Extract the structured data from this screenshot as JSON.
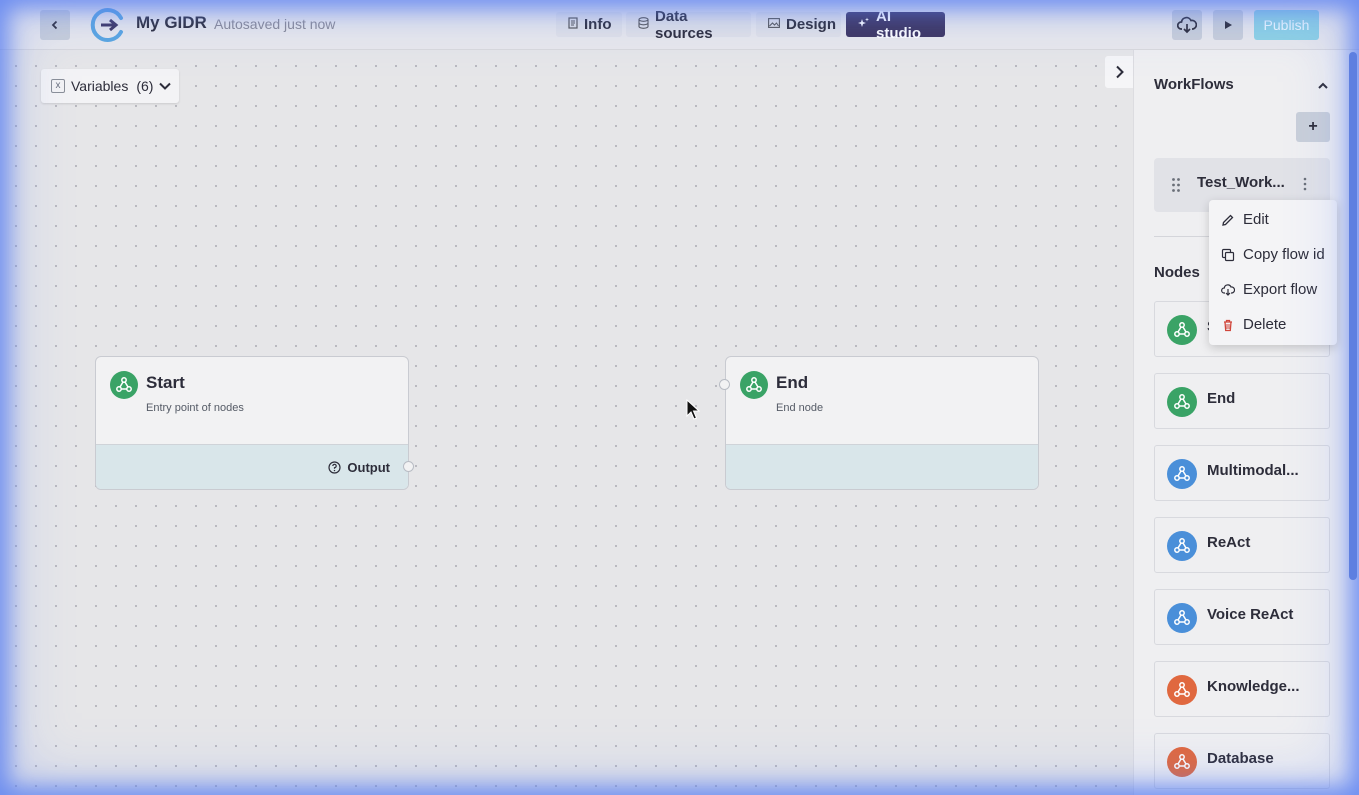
{
  "header": {
    "app_title": "My GIDR",
    "autosave_status": "Autosaved just now",
    "tabs": [
      {
        "label": "Info",
        "icon": "document-icon"
      },
      {
        "label": "Data sources",
        "icon": "database-icon"
      },
      {
        "label": "Design",
        "icon": "image-icon"
      },
      {
        "label": "AI studio",
        "icon": "sparkle-icon",
        "active": true
      }
    ],
    "publish_label": "Publish"
  },
  "canvas": {
    "variables_label": "Variables",
    "variables_count": "(6)",
    "nodes": [
      {
        "title": "Start",
        "subtitle": "Entry point of nodes",
        "output_label": "Output"
      },
      {
        "title": "End",
        "subtitle": "End node"
      }
    ]
  },
  "sidebar": {
    "workflows_title": "WorkFlows",
    "add_label": "+",
    "flow_name": "Test_Work...",
    "nodes_title": "Nodes",
    "node_palette": [
      {
        "label": "S",
        "color": "#3aa366"
      },
      {
        "label": "End",
        "color": "#3aa366"
      },
      {
        "label": "Multimodal...",
        "color": "#4a8fd9"
      },
      {
        "label": "ReAct",
        "color": "#4a8fd9"
      },
      {
        "label": "Voice ReAct",
        "color": "#4a8fd9"
      },
      {
        "label": "Knowledge...",
        "color": "#e0683f"
      },
      {
        "label": "Database",
        "color": "#e0683f"
      }
    ]
  },
  "context_menu": {
    "items": [
      {
        "label": "Edit",
        "icon": "pencil-icon"
      },
      {
        "label": "Copy flow id",
        "icon": "copy-icon"
      },
      {
        "label": "Export flow",
        "icon": "export-icon"
      },
      {
        "label": "Delete",
        "icon": "trash-icon"
      }
    ]
  },
  "colors": {
    "accent_dark": "#3d3561",
    "publish_bg": "#8ed2e4",
    "node_green": "#3aa366",
    "node_blue": "#4a8fd9",
    "node_orange": "#e0683f",
    "delete_red": "#d0453a"
  }
}
